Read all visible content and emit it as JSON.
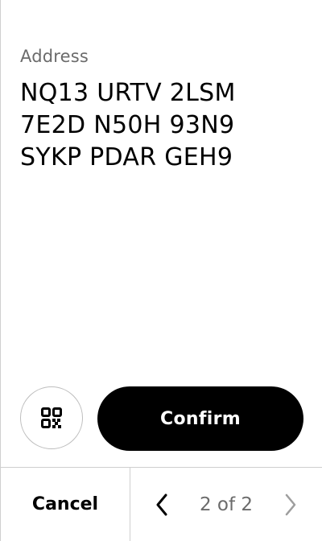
{
  "address": {
    "label": "Address",
    "lines": [
      "NQ13 URTV 2LSM",
      "7E2D N50H 93N9",
      "SYKP PDAR GEH9"
    ]
  },
  "actions": {
    "qr_icon": "qr-code-icon",
    "confirm_label": "Confirm"
  },
  "footer": {
    "cancel_label": "Cancel",
    "prev_icon": "chevron-left-icon",
    "next_icon": "chevron-right-icon",
    "pager_text": "2 of 2",
    "current_page": 2,
    "total_pages": 2
  },
  "colors": {
    "primary": "#000000",
    "muted_text": "#6b6b6b",
    "disabled_icon": "#9e9e9e",
    "border": "#cfcfcf"
  }
}
